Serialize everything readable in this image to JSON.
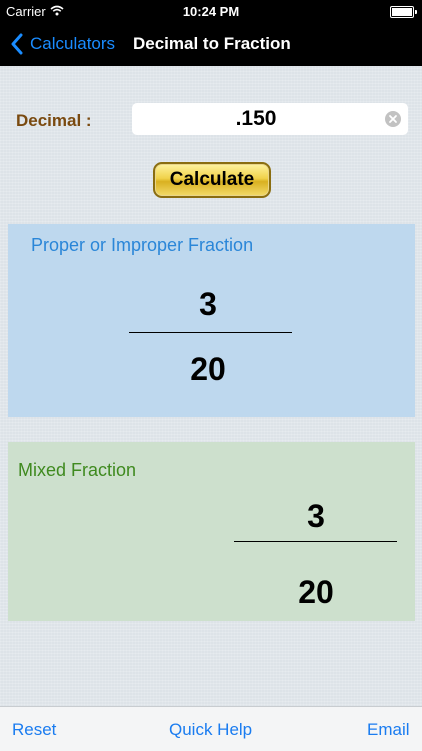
{
  "status_bar": {
    "carrier": "Carrier",
    "time": "10:24 PM"
  },
  "nav": {
    "back_label": "Calculators",
    "title": "Decimal to Fraction"
  },
  "decimal": {
    "label": "Decimal :",
    "value": ".150"
  },
  "calculate_label": "Calculate",
  "proper_fraction": {
    "title": "Proper or Improper Fraction",
    "numerator": "3",
    "denominator": "20"
  },
  "mixed_fraction": {
    "title": "Mixed Fraction",
    "numerator": "3",
    "denominator": "20"
  },
  "toolbar": {
    "reset_label": "Reset",
    "help_label": "Quick Help",
    "email_label": "Email"
  },
  "colors": {
    "accent": "#1a7cf0",
    "proper_panel": "#bed8ee",
    "mixed_panel": "#cde0cd"
  }
}
